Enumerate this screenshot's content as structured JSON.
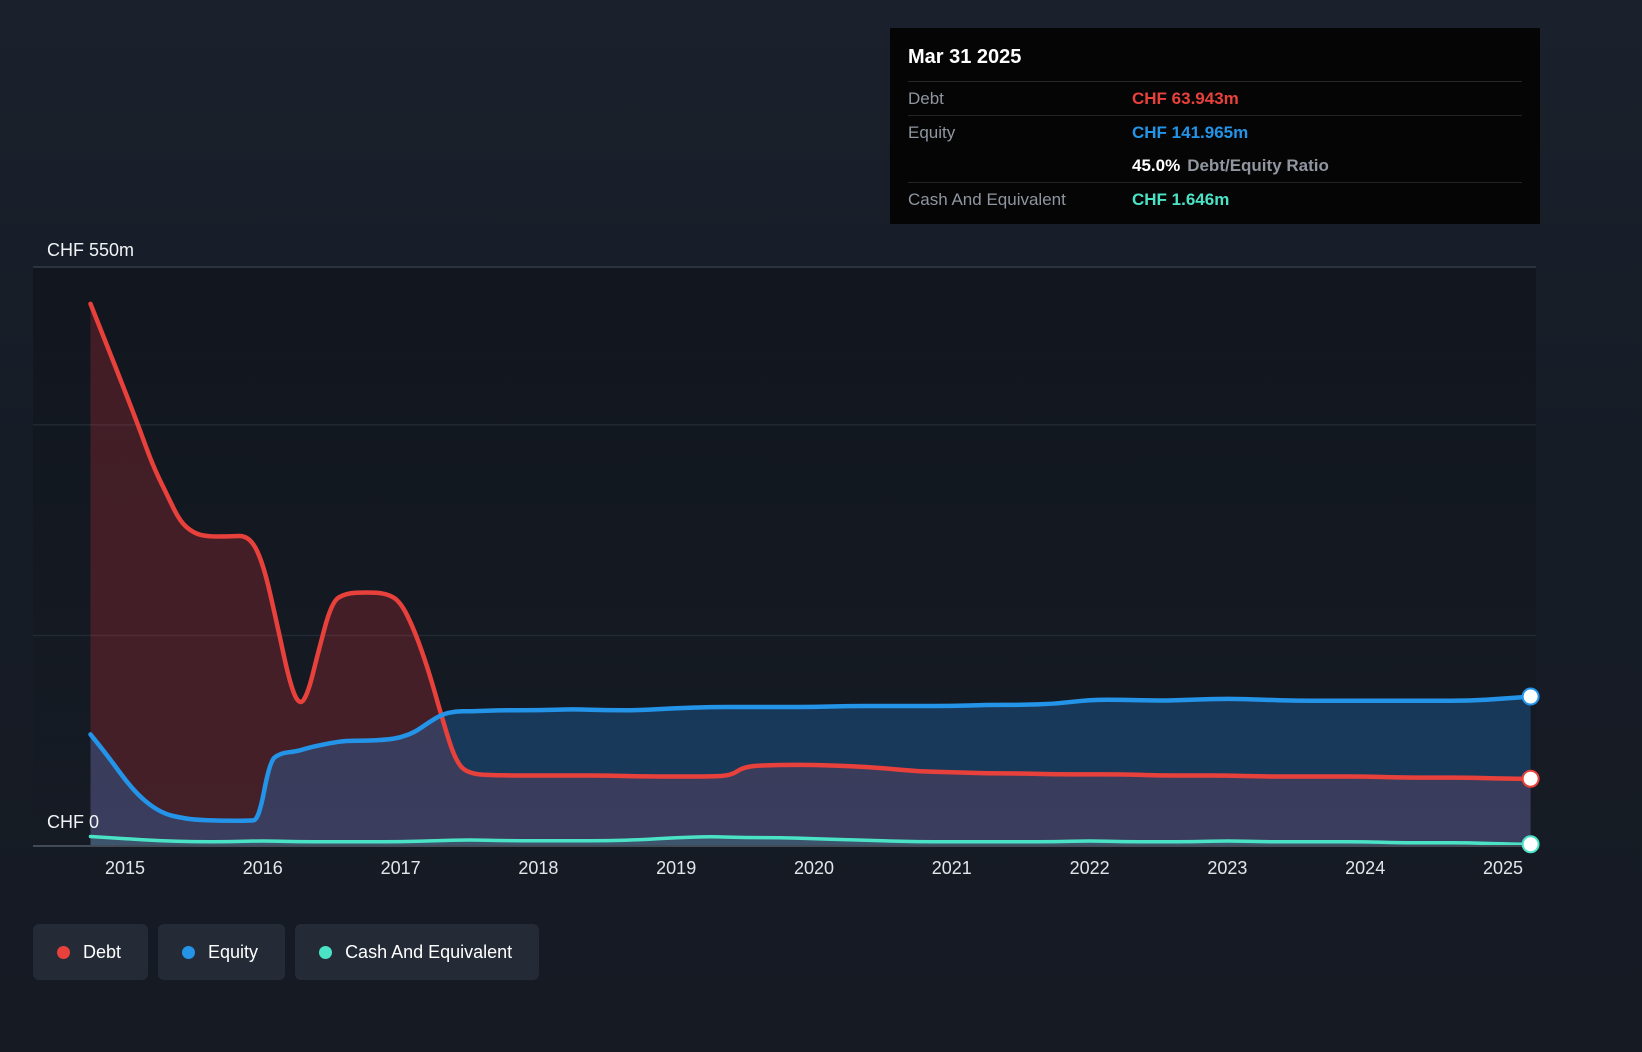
{
  "tooltip": {
    "title": "Mar 31 2025",
    "debt_label": "Debt",
    "debt_value": "CHF 63.943m",
    "equity_label": "Equity",
    "equity_value": "CHF 141.965m",
    "ratio_value": "45.0%",
    "ratio_label": "Debt/Equity Ratio",
    "cash_label": "Cash And Equivalent",
    "cash_value": "CHF 1.646m"
  },
  "chart_data": {
    "type": "area",
    "unit": "CHF millions",
    "ylim": [
      0,
      550
    ],
    "gridlines": [
      550,
      400,
      200
    ],
    "y_axis": {
      "top_label": "CHF 550m",
      "zero_label": "CHF 0"
    },
    "x_ticks": [
      "2015",
      "2016",
      "2017",
      "2018",
      "2019",
      "2020",
      "2021",
      "2022",
      "2023",
      "2024",
      "2025"
    ],
    "legend_position": "bottom-left",
    "series": [
      {
        "name": "Debt",
        "color": "#e8413c",
        "fill": "rgba(222,49,58,0.24)",
        "width": 4.5,
        "points": [
          [
            2014.75,
            515
          ],
          [
            2014.85,
            482
          ],
          [
            2015.0,
            432
          ],
          [
            2015.1,
            398
          ],
          [
            2015.2,
            362
          ],
          [
            2015.3,
            335
          ],
          [
            2015.4,
            308
          ],
          [
            2015.5,
            297
          ],
          [
            2015.6,
            294
          ],
          [
            2015.75,
            294
          ],
          [
            2015.9,
            295
          ],
          [
            2016.0,
            270
          ],
          [
            2016.1,
            213
          ],
          [
            2016.2,
            152
          ],
          [
            2016.27,
            133
          ],
          [
            2016.33,
            146
          ],
          [
            2016.4,
            183
          ],
          [
            2016.5,
            232
          ],
          [
            2016.6,
            240
          ],
          [
            2016.75,
            241
          ],
          [
            2016.9,
            240
          ],
          [
            2017.0,
            232
          ],
          [
            2017.1,
            205
          ],
          [
            2017.2,
            168
          ],
          [
            2017.3,
            122
          ],
          [
            2017.4,
            80
          ],
          [
            2017.5,
            68
          ],
          [
            2017.75,
            67
          ],
          [
            2018.0,
            67
          ],
          [
            2018.25,
            67
          ],
          [
            2018.5,
            67
          ],
          [
            2018.75,
            66
          ],
          [
            2019.0,
            66
          ],
          [
            2019.25,
            66
          ],
          [
            2019.4,
            67
          ],
          [
            2019.5,
            76
          ],
          [
            2019.75,
            77
          ],
          [
            2020.0,
            77
          ],
          [
            2020.25,
            76
          ],
          [
            2020.5,
            74
          ],
          [
            2020.75,
            71
          ],
          [
            2021.0,
            70
          ],
          [
            2021.25,
            69
          ],
          [
            2021.5,
            69
          ],
          [
            2021.75,
            68
          ],
          [
            2022.0,
            68
          ],
          [
            2022.25,
            68
          ],
          [
            2022.5,
            67
          ],
          [
            2022.75,
            67
          ],
          [
            2023.0,
            67
          ],
          [
            2023.25,
            66
          ],
          [
            2023.5,
            66
          ],
          [
            2023.75,
            66
          ],
          [
            2024.0,
            66
          ],
          [
            2024.25,
            65
          ],
          [
            2024.5,
            65
          ],
          [
            2024.75,
            65
          ],
          [
            2025.0,
            64
          ],
          [
            2025.2,
            63.943
          ]
        ]
      },
      {
        "name": "Equity",
        "color": "#2394e8",
        "fill": "rgba(36,130,216,0.30)",
        "width": 4.5,
        "points": [
          [
            2014.75,
            106
          ],
          [
            2014.85,
            90
          ],
          [
            2015.0,
            63
          ],
          [
            2015.1,
            48
          ],
          [
            2015.2,
            37
          ],
          [
            2015.3,
            30
          ],
          [
            2015.4,
            27
          ],
          [
            2015.5,
            25
          ],
          [
            2015.7,
            24
          ],
          [
            2015.9,
            24
          ],
          [
            2015.97,
            25
          ],
          [
            2016.05,
            80
          ],
          [
            2016.12,
            88
          ],
          [
            2016.25,
            90
          ],
          [
            2016.35,
            94
          ],
          [
            2016.5,
            98
          ],
          [
            2016.6,
            100
          ],
          [
            2016.75,
            100
          ],
          [
            2016.9,
            101
          ],
          [
            2017.0,
            103
          ],
          [
            2017.1,
            108
          ],
          [
            2017.2,
            117
          ],
          [
            2017.3,
            125
          ],
          [
            2017.4,
            128
          ],
          [
            2017.5,
            128
          ],
          [
            2017.75,
            129
          ],
          [
            2018.0,
            129
          ],
          [
            2018.25,
            130
          ],
          [
            2018.5,
            129
          ],
          [
            2018.75,
            129
          ],
          [
            2019.0,
            131
          ],
          [
            2019.25,
            132
          ],
          [
            2019.5,
            132
          ],
          [
            2019.75,
            132
          ],
          [
            2020.0,
            132
          ],
          [
            2020.25,
            133
          ],
          [
            2020.5,
            133
          ],
          [
            2020.75,
            133
          ],
          [
            2021.0,
            133
          ],
          [
            2021.25,
            134
          ],
          [
            2021.5,
            134
          ],
          [
            2021.75,
            135
          ],
          [
            2022.0,
            139
          ],
          [
            2022.25,
            139
          ],
          [
            2022.5,
            138
          ],
          [
            2022.75,
            139
          ],
          [
            2023.0,
            140
          ],
          [
            2023.25,
            139
          ],
          [
            2023.5,
            138
          ],
          [
            2023.75,
            138
          ],
          [
            2024.0,
            138
          ],
          [
            2024.25,
            138
          ],
          [
            2024.5,
            138
          ],
          [
            2024.75,
            138
          ],
          [
            2025.0,
            140
          ],
          [
            2025.2,
            141.965
          ]
        ]
      },
      {
        "name": "Cash And Equivalent",
        "color": "#4be3c6",
        "fill": "rgba(75,227,198,0.15)",
        "width": 3.5,
        "points": [
          [
            2014.75,
            9
          ],
          [
            2015.0,
            7
          ],
          [
            2015.25,
            5
          ],
          [
            2015.5,
            4
          ],
          [
            2015.75,
            4
          ],
          [
            2016.0,
            5
          ],
          [
            2016.25,
            4
          ],
          [
            2016.5,
            4
          ],
          [
            2016.75,
            4
          ],
          [
            2017.0,
            4
          ],
          [
            2017.25,
            5
          ],
          [
            2017.5,
            6
          ],
          [
            2017.75,
            5
          ],
          [
            2018.0,
            5
          ],
          [
            2018.25,
            5
          ],
          [
            2018.5,
            5
          ],
          [
            2018.75,
            6
          ],
          [
            2019.0,
            8
          ],
          [
            2019.25,
            9
          ],
          [
            2019.5,
            8
          ],
          [
            2019.75,
            8
          ],
          [
            2020.0,
            7
          ],
          [
            2020.25,
            6
          ],
          [
            2020.5,
            5
          ],
          [
            2020.75,
            4
          ],
          [
            2021.0,
            4
          ],
          [
            2021.25,
            4
          ],
          [
            2021.5,
            4
          ],
          [
            2021.75,
            4
          ],
          [
            2022.0,
            5
          ],
          [
            2022.25,
            4
          ],
          [
            2022.5,
            4
          ],
          [
            2022.75,
            4
          ],
          [
            2023.0,
            5
          ],
          [
            2023.25,
            4
          ],
          [
            2023.5,
            4
          ],
          [
            2023.75,
            4
          ],
          [
            2024.0,
            4
          ],
          [
            2024.25,
            3
          ],
          [
            2024.5,
            3
          ],
          [
            2024.75,
            3
          ],
          [
            2025.0,
            2
          ],
          [
            2025.2,
            1.646
          ]
        ]
      }
    ]
  }
}
